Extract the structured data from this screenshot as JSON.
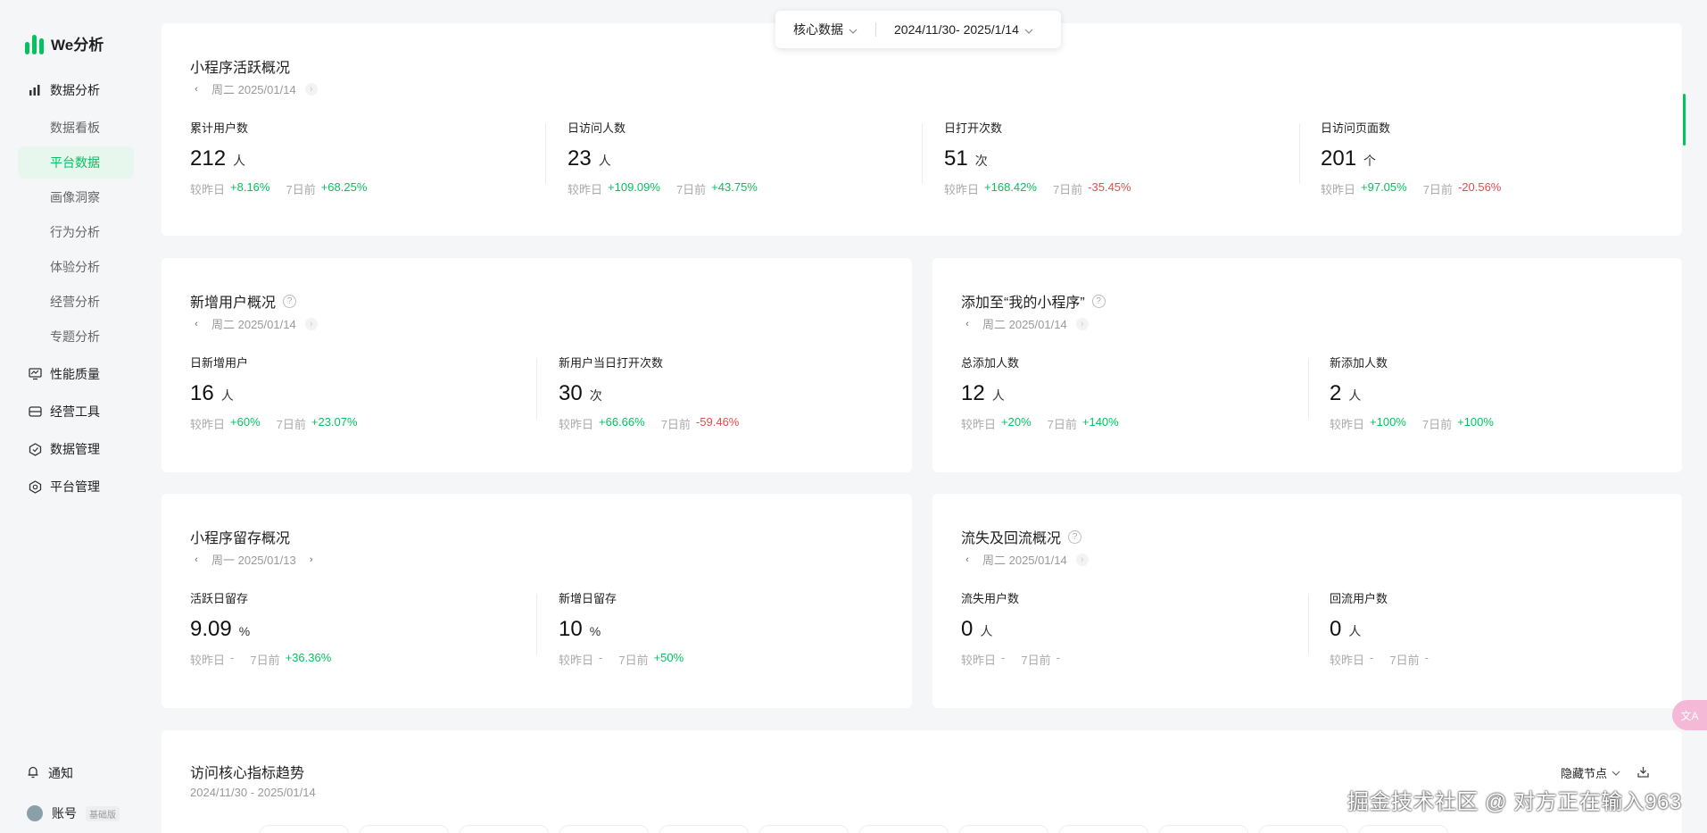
{
  "app": {
    "logo_text": "We分析",
    "brand_color": "#07c160"
  },
  "sidebar": {
    "items": [
      {
        "label": "数据分析",
        "icon": "bar-chart-icon"
      },
      {
        "label": "数据看板"
      },
      {
        "label": "平台数据",
        "active": true
      },
      {
        "label": "画像洞察"
      },
      {
        "label": "行为分析"
      },
      {
        "label": "体验分析"
      },
      {
        "label": "经营分析"
      },
      {
        "label": "专题分析"
      },
      {
        "label": "性能质量",
        "icon": "monitor-icon"
      },
      {
        "label": "经营工具",
        "icon": "toolbox-icon"
      },
      {
        "label": "数据管理",
        "icon": "hexagon-check-icon"
      },
      {
        "label": "平台管理",
        "icon": "hexagon-gear-icon"
      }
    ],
    "notify_label": "通知",
    "account_label": "账号",
    "account_badge": "基础版"
  },
  "topbar": {
    "category": "核心数据",
    "date_range": "2024/11/30- 2025/1/14"
  },
  "active_overview": {
    "title": "小程序活跃概况",
    "date": "周二 2025/01/14",
    "metrics": [
      {
        "label": "累计用户数",
        "value": "212",
        "unit": "人",
        "day": "+8.16%",
        "week": "+68.25%"
      },
      {
        "label": "日访问人数",
        "value": "23",
        "unit": "人",
        "day": "+109.09%",
        "week": "+43.75%"
      },
      {
        "label": "日打开次数",
        "value": "51",
        "unit": "次",
        "day": "+168.42%",
        "week": "-35.45%"
      },
      {
        "label": "日访问页面数",
        "value": "201",
        "unit": "个",
        "day": "+97.05%",
        "week": "-20.56%"
      }
    ]
  },
  "new_users": {
    "title": "新增用户概况",
    "date": "周二 2025/01/14",
    "metrics": [
      {
        "label": "日新增用户",
        "value": "16",
        "unit": "人",
        "day": "+60%",
        "week": "+23.07%"
      },
      {
        "label": "新用户当日打开次数",
        "value": "30",
        "unit": "次",
        "day": "+66.66%",
        "week": "-59.46%"
      }
    ]
  },
  "my_program": {
    "title": "添加至“我的小程序”",
    "date": "周二 2025/01/14",
    "metrics": [
      {
        "label": "总添加人数",
        "value": "12",
        "unit": "人",
        "day": "+20%",
        "week": "+140%"
      },
      {
        "label": "新添加人数",
        "value": "2",
        "unit": "人",
        "day": "+100%",
        "week": "+100%"
      }
    ]
  },
  "retention": {
    "title": "小程序留存概况",
    "date": "周一 2025/01/13",
    "metrics": [
      {
        "label": "活跃日留存",
        "value": "9.09",
        "unit": "%",
        "day": "-",
        "week": "+36.36%"
      },
      {
        "label": "新增日留存",
        "value": "10",
        "unit": "%",
        "day": "-",
        "week": "+50%"
      }
    ]
  },
  "churn": {
    "title": "流失及回流概况",
    "date": "周二 2025/01/14",
    "metrics": [
      {
        "label": "流失用户数",
        "value": "0",
        "unit": "人",
        "day": "-",
        "week": "-"
      },
      {
        "label": "回流用户数",
        "value": "0",
        "unit": "人",
        "day": "-",
        "week": "-"
      }
    ]
  },
  "trend": {
    "title": "访问核心指标趋势",
    "date_range": "2024/11/30 - 2025/01/14",
    "hide_nodes_label": "隐藏节点"
  },
  "labels": {
    "vs_yesterday": "较昨日",
    "vs_7days": "7日前"
  },
  "watermark": "掘金技术社区 @ 对方正在输入963",
  "translate_icon_text": "文A"
}
